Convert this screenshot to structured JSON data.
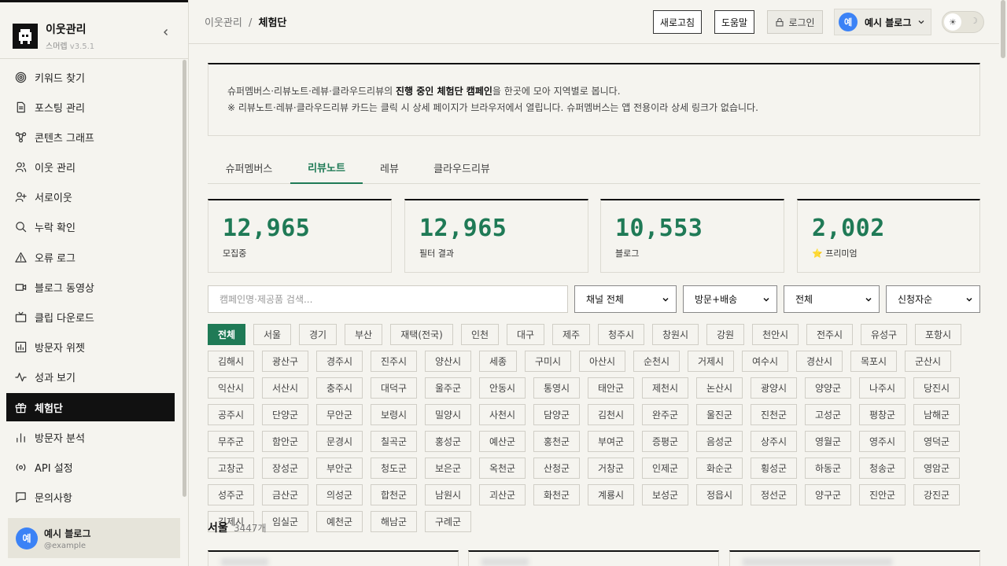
{
  "sidebar": {
    "app_name": "이웃관리",
    "app_sub": "스머렙",
    "version": "v3.5.1",
    "items": [
      {
        "label": "키워드 찾기",
        "icon": "target-icon"
      },
      {
        "label": "포스팅 관리",
        "icon": "document-icon"
      },
      {
        "label": "콘텐츠 그래프",
        "icon": "graph-icon"
      },
      {
        "label": "이웃 관리",
        "icon": "users-icon"
      },
      {
        "label": "서로이웃",
        "icon": "user-plus-icon"
      },
      {
        "label": "누락 확인",
        "icon": "search-icon"
      },
      {
        "label": "오류 로그",
        "icon": "warning-icon"
      },
      {
        "label": "블로그 동영상",
        "icon": "video-icon"
      },
      {
        "label": "클립 다운로드",
        "icon": "tv-icon"
      },
      {
        "label": "방문자 위젯",
        "icon": "image-chart-icon"
      },
      {
        "label": "성과 보기",
        "icon": "activity-icon"
      },
      {
        "label": "체험단",
        "icon": "gift-icon"
      },
      {
        "label": "방문자 분석",
        "icon": "bar-chart-icon"
      },
      {
        "label": "API 설정",
        "icon": "api-icon"
      },
      {
        "label": "문의사항",
        "icon": "message-icon"
      }
    ],
    "active_index": 11,
    "user": {
      "avatar": "예",
      "name": "예시 블로그",
      "handle": "@example"
    }
  },
  "header": {
    "crumb_parent": "이웃관리",
    "crumb_sep": "/",
    "crumb_current": "체험단",
    "refresh_label": "새로고침",
    "help_label": "도움말",
    "login_label": "로그인",
    "blog_avatar": "예",
    "blog_name": "예시 블로그",
    "theme_sun": "☀",
    "theme_moon": "☽"
  },
  "notice": {
    "line1_pre": "슈퍼멤버스·리뷰노트·레뷰·클라우드리뷰의 ",
    "line1_bold": "진행 중인 체험단 캠페인",
    "line1_post": "을 한곳에 모아 지역별로 봅니다.",
    "line2": "※ 리뷰노트·레뷰·클라우드리뷰 카드는 클릭 시 상세 페이지가 브라우저에서 열립니다. 슈퍼멤버스는 앱 전용이라 상세 링크가 없습니다."
  },
  "tabs": [
    "슈퍼멤버스",
    "리뷰노트",
    "레뷰",
    "클라우드리뷰"
  ],
  "active_tab": 1,
  "stats": [
    {
      "value": "12,965",
      "label": "모집중"
    },
    {
      "value": "12,965",
      "label": "필터 결과"
    },
    {
      "value": "10,553",
      "label": "블로그"
    },
    {
      "value": "2,002",
      "label": "⭐ 프리미엄"
    }
  ],
  "filters": {
    "search_placeholder": "캠페인명·제공품 검색...",
    "channel": "채널 전체",
    "type": "방문+배송",
    "category": "전체",
    "sort": "신청자순"
  },
  "regions": [
    "전체",
    "서울",
    "경기",
    "부산",
    "재택(전국)",
    "인천",
    "대구",
    "제주",
    "청주시",
    "창원시",
    "강원",
    "천안시",
    "전주시",
    "유성구",
    "포항시",
    "김해시",
    "광산구",
    "경주시",
    "진주시",
    "양산시",
    "세종",
    "구미시",
    "아산시",
    "순천시",
    "거제시",
    "여수시",
    "경산시",
    "목포시",
    "군산시",
    "익산시",
    "서산시",
    "충주시",
    "대덕구",
    "울주군",
    "안동시",
    "통영시",
    "태안군",
    "제천시",
    "논산시",
    "광양시",
    "양양군",
    "나주시",
    "당진시",
    "공주시",
    "단양군",
    "무안군",
    "보령시",
    "밀양시",
    "사천시",
    "담양군",
    "김천시",
    "완주군",
    "울진군",
    "진천군",
    "고성군",
    "평창군",
    "남해군",
    "무주군",
    "함안군",
    "문경시",
    "칠곡군",
    "홍성군",
    "예산군",
    "홍천군",
    "부여군",
    "증평군",
    "음성군",
    "상주시",
    "영월군",
    "영주시",
    "영덕군",
    "고창군",
    "장성군",
    "부안군",
    "청도군",
    "보은군",
    "옥천군",
    "산청군",
    "거창군",
    "인제군",
    "화순군",
    "횡성군",
    "하동군",
    "청송군",
    "영암군",
    "성주군",
    "금산군",
    "의성군",
    "합천군",
    "남원시",
    "괴산군",
    "화천군",
    "계룡시",
    "보성군",
    "정읍시",
    "정선군",
    "양구군",
    "진안군",
    "강진군",
    "김제시",
    "임실군",
    "예천군",
    "해남군",
    "구례군"
  ],
  "section": {
    "title": "서울",
    "count": "3447개"
  }
}
